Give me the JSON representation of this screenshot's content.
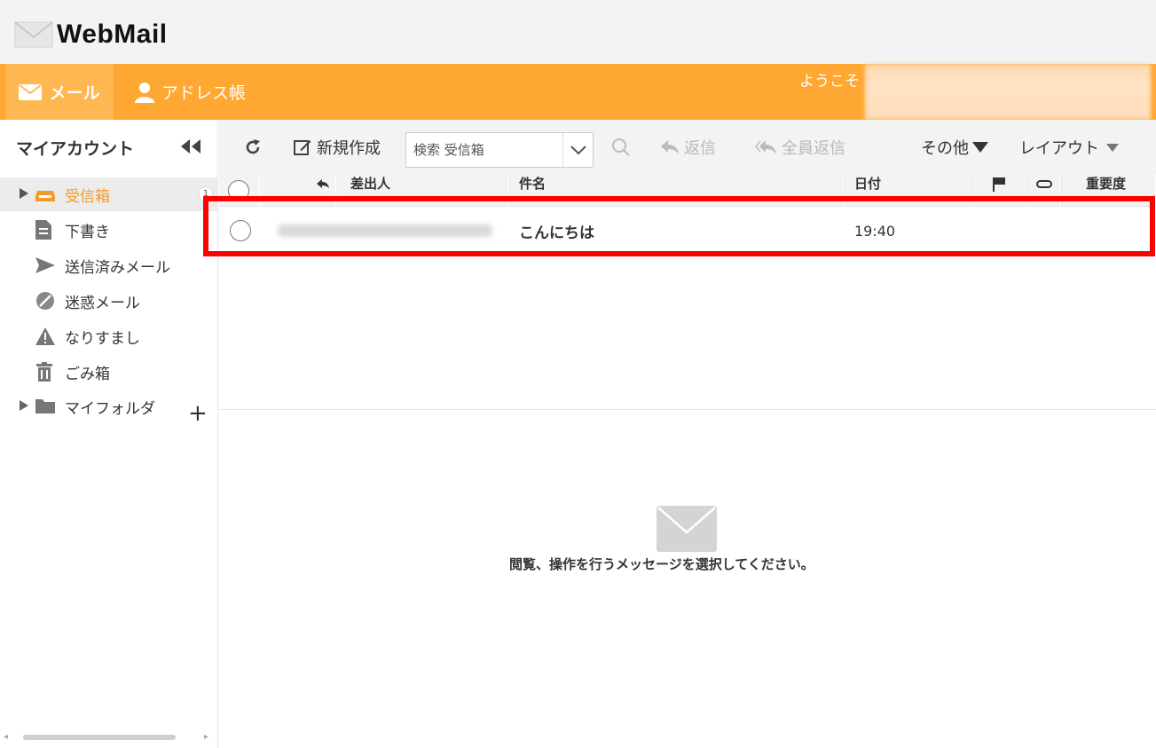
{
  "app": {
    "logo_text": "WebMail"
  },
  "nav": {
    "mail_label": "メール",
    "address_book_label": "アドレス帳",
    "welcome_text": "ようこそ"
  },
  "sidebar": {
    "title": "マイアカウント",
    "folders": [
      {
        "label": "受信箱",
        "icon": "inbox-icon",
        "badge": "1",
        "active": true
      },
      {
        "label": "下書き",
        "icon": "draft-icon"
      },
      {
        "label": "送信済みメール",
        "icon": "sent-icon"
      },
      {
        "label": "迷惑メール",
        "icon": "spam-icon"
      },
      {
        "label": "なりすまし",
        "icon": "warning-icon"
      },
      {
        "label": "ごみ箱",
        "icon": "trash-icon"
      },
      {
        "label": "マイフォルダ",
        "icon": "folder-icon"
      }
    ],
    "add_label": "+"
  },
  "toolbar": {
    "new_label": "新規作成",
    "search_placeholder": "検索 受信箱",
    "reply_label": "返信",
    "reply_all_label": "全員返信",
    "other_label": "その他",
    "layout_label": "レイアウト"
  },
  "table": {
    "headers": {
      "sender": "差出人",
      "subject": "件名",
      "date": "日付",
      "priority": "重要度"
    },
    "rows": [
      {
        "subject": "こんにちは",
        "date": "19:40"
      }
    ]
  },
  "preview": {
    "message": "閲覧、操作を行うメッセージを選択してください。"
  },
  "colors": {
    "accent": "#ffa733",
    "active_folder_text": "#f29b2c",
    "highlight": "#ff0000"
  }
}
